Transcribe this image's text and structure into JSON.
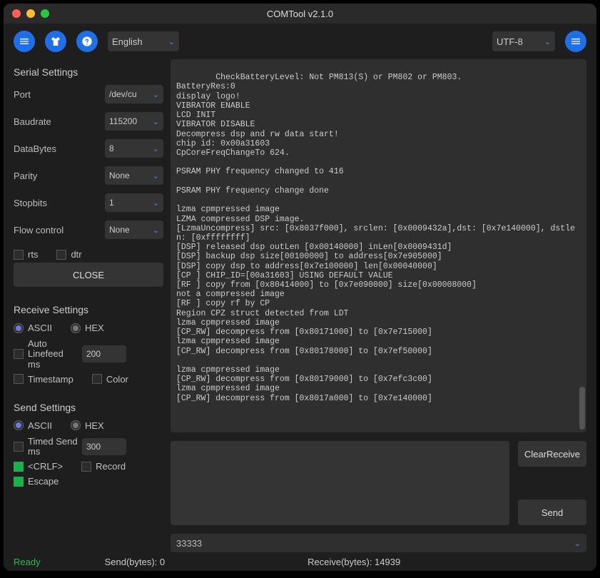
{
  "window": {
    "title": "COMTool v2.1.0"
  },
  "toolbar": {
    "language": "English",
    "encoding": "UTF-8"
  },
  "serial": {
    "title": "Serial Settings",
    "port_label": "Port",
    "port_value": "/dev/cu",
    "baud_label": "Baudrate",
    "baud_value": "115200",
    "databytes_label": "DataBytes",
    "databytes_value": "8",
    "parity_label": "Parity",
    "parity_value": "None",
    "stopbits_label": "Stopbits",
    "stopbits_value": "1",
    "flow_label": "Flow control",
    "flow_value": "None",
    "rts_label": "rts",
    "dtr_label": "dtr",
    "close_label": "CLOSE"
  },
  "receive": {
    "title": "Receive Settings",
    "ascii_label": "ASCII",
    "hex_label": "HEX",
    "linefeed_label": "Auto Linefeed ms",
    "linefeed_value": "200",
    "timestamp_label": "Timestamp",
    "color_label": "Color"
  },
  "send": {
    "title": "Send Settings",
    "ascii_label": "ASCII",
    "hex_label": "HEX",
    "timed_label": "Timed Send ms",
    "timed_value": "300",
    "crlf_label": "<CRLF>",
    "record_label": "Record",
    "escape_label": "Escape"
  },
  "console_text": "CheckBatteryLevel: Not PM813(S) or PM802 or PM803.\nBatteryRes:0\ndisplay logo!\nVIBRATOR ENABLE\nLCD INIT\nVIBRATOR DISABLE\nDecompress dsp and rw data start!\nchip id: 0x00a31603\nCpCoreFreqChangeTo 624.\n\nPSRAM PHY frequency changed to 416\n\nPSRAM PHY frequency change done\n\nlzma cpmpressed image\nLZMA compressed DSP image.\n[LzmaUncompress] src: [0x8037f000], srclen: [0x0009432a],dst: [0x7e140000], dstlen: [0xffffffff]\n[DSP] released dsp outLen [0x00140000] inLen[0x0009431d]\n[DSP] backup dsp size[00100000] to address[0x7e905000]\n[DSP] copy dsp to address[0x7e100000] len[0x00040000]\n[CP ] CHIP_ID=[00a31603] USING DEFAULT VALUE\n[RF ] copy from [0x80414000] to [0x7e090000] size[0x00008000]\nnot a compressed image\n[RF ] copy rf by CP\nRegion CPZ struct detected from LDT\nlzma cpmpressed image\n[CP_RW] decompress from [0x80171000] to [0x7e715000]\nlzma cpmpressed image\n[CP_RW] decompress from [0x80178000] to [0x7ef50000]\n\nlzma cpmpressed image\n[CP_RW] decompress from [0x80179000] to [0x7efc3c00]\nlzma cpmpressed image\n[CP_RW] decompress from [0x8017a000] to [0x7e140000]",
  "actions": {
    "clear_receive": "ClearReceive",
    "send": "Send"
  },
  "history_value": "33333",
  "status": {
    "ready": "Ready",
    "send_label": "Send(bytes): 0",
    "recv_label": "Receive(bytes): 14939"
  }
}
